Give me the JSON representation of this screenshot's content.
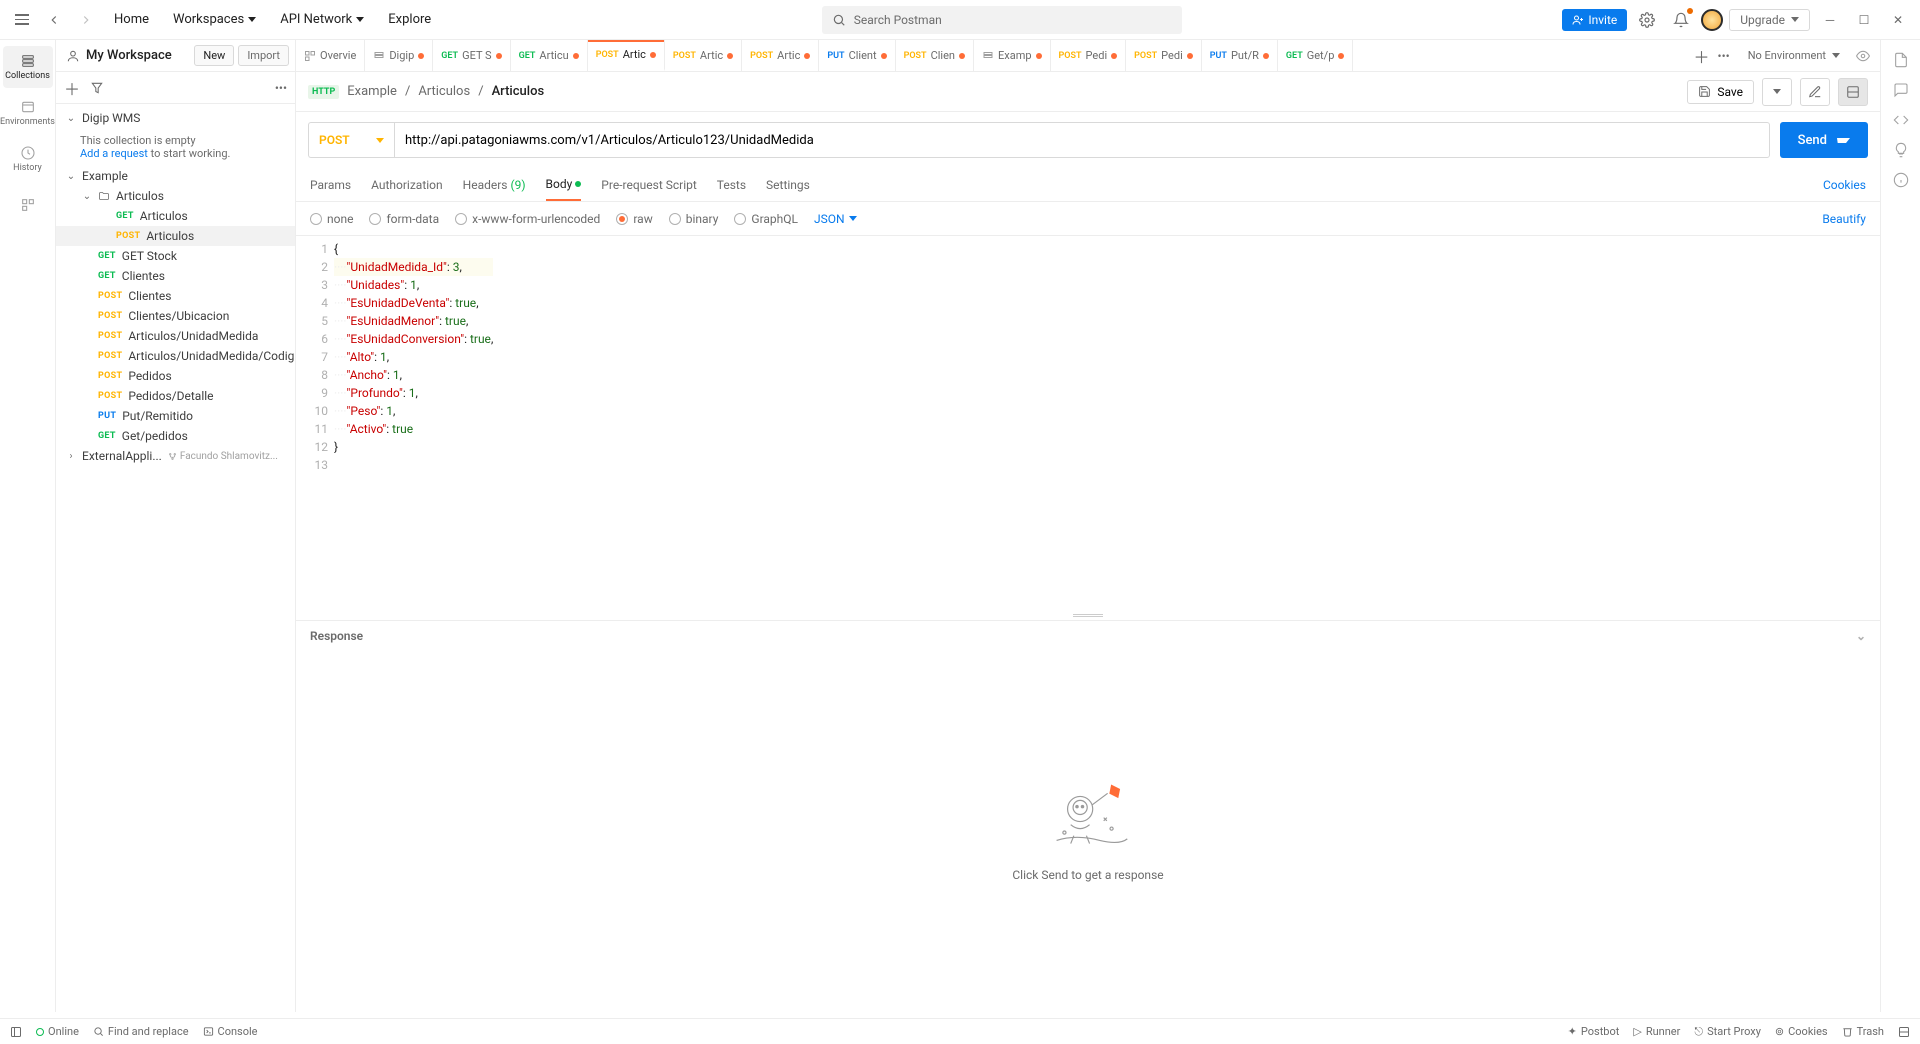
{
  "topnav": {
    "home": "Home",
    "workspaces": "Workspaces",
    "apinetwork": "API Network",
    "explore": "Explore",
    "search_placeholder": "Search Postman",
    "invite": "Invite",
    "upgrade": "Upgrade"
  },
  "workspace": {
    "name": "My Workspace",
    "new_btn": "New",
    "import_btn": "Import"
  },
  "leftbar": [
    {
      "label": "Collections"
    },
    {
      "label": "Environments"
    },
    {
      "label": "History"
    }
  ],
  "tabs": [
    {
      "method": "",
      "label": "Overvie",
      "kind": "overview"
    },
    {
      "method": "",
      "label": "Digip",
      "kind": "coll",
      "dot": true
    },
    {
      "method": "GET",
      "label": "GET S",
      "dot": true
    },
    {
      "method": "GET",
      "label": "Articu",
      "dot": true
    },
    {
      "method": "POST",
      "label": "Artic",
      "dot": true,
      "active": true
    },
    {
      "method": "POST",
      "label": "Artic",
      "dot": true
    },
    {
      "method": "POST",
      "label": "Artic",
      "dot": true
    },
    {
      "method": "PUT",
      "label": "Client",
      "dot": true
    },
    {
      "method": "POST",
      "label": "Clien",
      "dot": true
    },
    {
      "method": "",
      "label": "Examp",
      "kind": "coll",
      "dot": true
    },
    {
      "method": "POST",
      "label": "Pedi",
      "dot": true
    },
    {
      "method": "POST",
      "label": "Pedi",
      "dot": true
    },
    {
      "method": "PUT",
      "label": "Put/R",
      "dot": true
    },
    {
      "method": "GET",
      "label": "Get/p",
      "dot": true
    }
  ],
  "env": {
    "value": "No Environment"
  },
  "collections": [
    {
      "name": "Digip WMS",
      "expanded": true,
      "empty_msg": "This collection is empty",
      "add_link": "Add a request",
      "to_start": " to start working."
    },
    {
      "name": "Example",
      "expanded": true,
      "folders": [
        {
          "name": "Articulos",
          "expanded": true,
          "requests": [
            {
              "method": "GET",
              "name": "Articulos"
            },
            {
              "method": "POST",
              "name": "Articulos",
              "selected": true
            }
          ]
        }
      ],
      "requests": [
        {
          "method": "GET",
          "name": "GET Stock"
        },
        {
          "method": "GET",
          "name": "Clientes"
        },
        {
          "method": "POST",
          "name": "Clientes"
        },
        {
          "method": "POST",
          "name": "Clientes/Ubicacion"
        },
        {
          "method": "POST",
          "name": "Articulos/UnidadMedida"
        },
        {
          "method": "POST",
          "name": "Articulos/UnidadMedida/Codig..."
        },
        {
          "method": "POST",
          "name": "Pedidos"
        },
        {
          "method": "POST",
          "name": "Pedidos/Detalle"
        },
        {
          "method": "PUT",
          "name": "Put/Remitido"
        },
        {
          "method": "GET",
          "name": "Get/pedidos"
        }
      ]
    },
    {
      "name": "ExternalAppli...",
      "fork": "Facundo Shlamovitz..."
    }
  ],
  "breadcrumb": [
    "Example",
    "Articulos",
    "Articulos"
  ],
  "save_label": "Save",
  "request": {
    "method": "POST",
    "url": "http://api.patagoniawms.com/v1/Articulos/Articulo123/UnidadMedida",
    "send": "Send"
  },
  "request_tabs": [
    {
      "label": "Params"
    },
    {
      "label": "Authorization"
    },
    {
      "label": "Headers",
      "suffix": "(9)"
    },
    {
      "label": "Body",
      "active": true,
      "mod": true
    },
    {
      "label": "Pre-request Script"
    },
    {
      "label": "Tests"
    },
    {
      "label": "Settings"
    }
  ],
  "cookies": "Cookies",
  "body_types": [
    {
      "label": "none"
    },
    {
      "label": "form-data"
    },
    {
      "label": "x-www-form-urlencoded"
    },
    {
      "label": "raw",
      "selected": true
    },
    {
      "label": "binary"
    },
    {
      "label": "GraphQL"
    }
  ],
  "body_format": "JSON",
  "beautify": "Beautify",
  "code_lines": [
    {
      "n": 1,
      "raw": "{"
    },
    {
      "n": 2,
      "key": "UnidadMedida_Id",
      "val": "3",
      "t": "num",
      "c": true,
      "hl": true
    },
    {
      "n": 3,
      "key": "Unidades",
      "val": "1",
      "t": "num",
      "c": true
    },
    {
      "n": 4,
      "key": "EsUnidadDeVenta",
      "val": "true",
      "t": "bool",
      "c": true
    },
    {
      "n": 5,
      "key": "EsUnidadMenor",
      "val": "true",
      "t": "bool",
      "c": true
    },
    {
      "n": 6,
      "key": "EsUnidadConversion",
      "val": "true",
      "t": "bool",
      "c": true
    },
    {
      "n": 7,
      "key": "Alto",
      "val": "1",
      "t": "num",
      "c": true
    },
    {
      "n": 8,
      "key": "Ancho",
      "val": "1",
      "t": "num",
      "c": true
    },
    {
      "n": 9,
      "key": "Profundo",
      "val": "1",
      "t": "num",
      "c": true
    },
    {
      "n": 10,
      "key": "Peso",
      "val": "1",
      "t": "num",
      "c": true
    },
    {
      "n": 11,
      "key": "Activo",
      "val": "true",
      "t": "bool",
      "c": false
    },
    {
      "n": 12,
      "raw": "}"
    },
    {
      "n": 13,
      "raw": ""
    }
  ],
  "response_label": "Response",
  "response_hint": "Click Send to get a response",
  "status": {
    "online": "Online",
    "find": "Find and replace",
    "console": "Console",
    "postbot": "Postbot",
    "runner": "Runner",
    "startproxy": "Start Proxy",
    "cookies": "Cookies",
    "trash": "Trash"
  }
}
